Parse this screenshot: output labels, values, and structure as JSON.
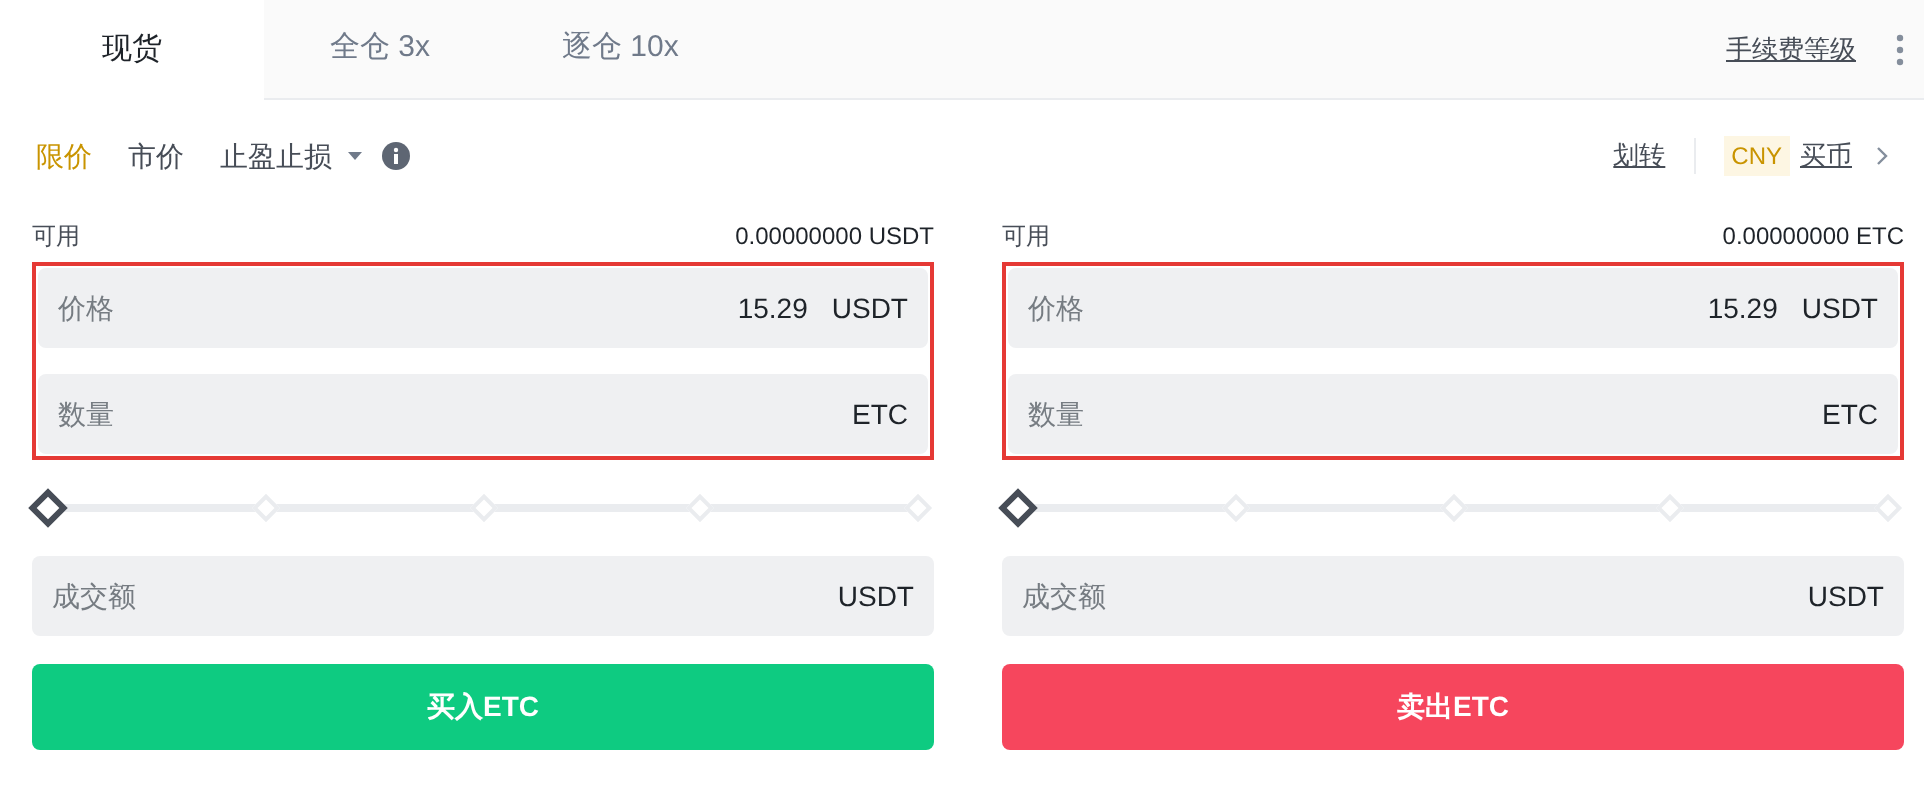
{
  "tabs": [
    {
      "label": "现货",
      "selected": true
    },
    {
      "label": "全仓 3x",
      "selected": false
    },
    {
      "label": "逐仓 10x",
      "selected": false
    }
  ],
  "fee_link": "手续费等级",
  "order_types": [
    {
      "label": "限价",
      "selected": true,
      "kind": "plain"
    },
    {
      "label": "市价",
      "selected": false,
      "kind": "plain"
    },
    {
      "label": "止盈止损",
      "selected": false,
      "kind": "dropdown"
    }
  ],
  "transfer_link": "划转",
  "currency_badge": "CNY",
  "buy_coin_link": "买币",
  "panels": [
    {
      "available_label": "可用",
      "available_value": "0.00000000 USDT",
      "price": {
        "label": "价格",
        "value": "15.29",
        "unit": "USDT"
      },
      "amount": {
        "label": "数量",
        "unit": "ETC"
      },
      "slider": {
        "level": 0
      },
      "total": {
        "label": "成交额",
        "unit": "USDT"
      },
      "button": {
        "label": "买入ETC",
        "kind": "buy"
      }
    },
    {
      "available_label": "可用",
      "available_value": "0.00000000 ETC",
      "price": {
        "label": "价格",
        "value": "15.29",
        "unit": "USDT"
      },
      "amount": {
        "label": "数量",
        "unit": "ETC"
      },
      "slider": {
        "level": 0
      },
      "total": {
        "label": "成交额",
        "unit": "USDT"
      },
      "button": {
        "label": "卖出ETC",
        "kind": "sell"
      }
    }
  ]
}
